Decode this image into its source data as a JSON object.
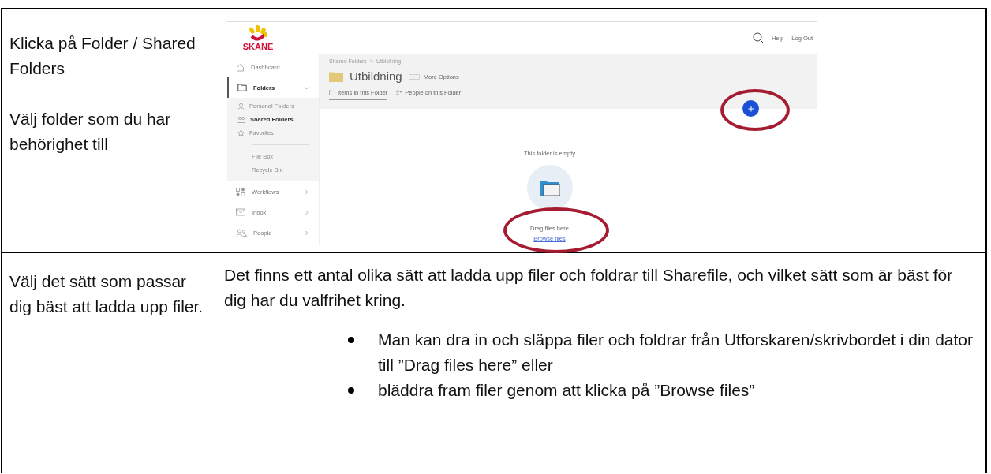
{
  "row_1": {
    "instruction_lines": [
      "Klicka på Folder / Shared Folders",
      "Välj folder som du har behörighet till"
    ],
    "screenshot": {
      "logo_text": "SKANE",
      "header_links": [
        "Help",
        "Log Out"
      ],
      "sidebar": [
        {
          "label": "Dashboard",
          "kind": "link"
        },
        {
          "label": "Folders",
          "kind": "group",
          "expanded": true,
          "selected": true,
          "children": [
            {
              "label": "Personal Folders",
              "selected": false,
              "divider_before": false
            },
            {
              "label": "Shared Folders",
              "selected": true,
              "divider_before": false
            },
            {
              "label": "Favorites",
              "selected": false,
              "divider_before": false
            },
            {
              "label": "File Box",
              "selected": false,
              "divider_before": true
            },
            {
              "label": "Recycle Bin",
              "selected": false,
              "divider_before": false
            }
          ]
        },
        {
          "label": "Workflows",
          "kind": "group",
          "expanded": false,
          "selected": false
        },
        {
          "label": "Inbox",
          "kind": "group",
          "expanded": false,
          "selected": false
        },
        {
          "label": "People",
          "kind": "group",
          "expanded": false,
          "selected": false
        }
      ],
      "breadcrumb": [
        "Shared Folders",
        "Utbildning"
      ],
      "breadcrumb_separator": ">",
      "folder_title": "Utbildning",
      "more_options": "More Options",
      "tabs": [
        {
          "label": "Items in this Folder",
          "selected": true
        },
        {
          "label": "People on this Folder",
          "selected": false
        }
      ],
      "empty_message": "This folder is empty",
      "drop_hint": "Drag files here",
      "browse_link": "Browse files"
    }
  },
  "row_2": {
    "instruction": "Välj det sätt som passar dig bäst att ladda upp filer.",
    "paragraph": "Det finns ett antal olika sätt att ladda upp filer och foldrar till Sharefile, och vilket sätt som är bäst för dig har du valfrihet kring.",
    "bullets": [
      "Man kan dra in och släppa filer och foldrar från Utforskaren/skrivbordet i din dator till ”Drag files here” eller",
      "bläddra fram filer genom att klicka på ”Browse files”"
    ]
  }
}
